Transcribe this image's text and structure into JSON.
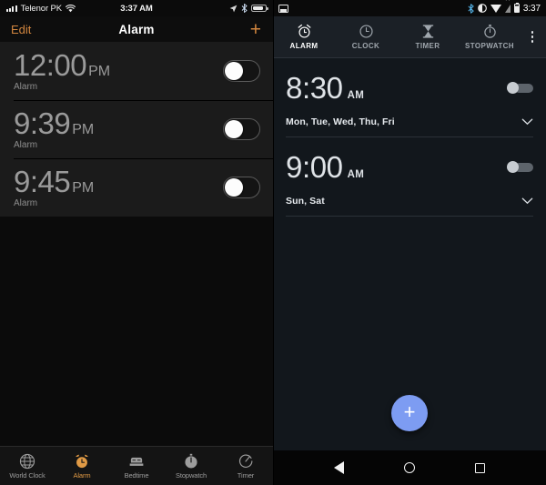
{
  "ios": {
    "status": {
      "carrier": "Telenor PK",
      "time": "3:37 AM",
      "icons": [
        "signal-bars-icon",
        "wifi-icon",
        "location-arrow-icon",
        "bluetooth-icon",
        "battery-icon"
      ]
    },
    "nav": {
      "edit_label": "Edit",
      "title": "Alarm",
      "add_label": "+"
    },
    "alarms": [
      {
        "time": "12:00",
        "meridiem": "PM",
        "label": "Alarm",
        "enabled": false
      },
      {
        "time": "9:39",
        "meridiem": "PM",
        "label": "Alarm",
        "enabled": false
      },
      {
        "time": "9:45",
        "meridiem": "PM",
        "label": "Alarm",
        "enabled": false
      }
    ],
    "tabs": [
      {
        "label": "World Clock",
        "icon": "globe-icon",
        "active": false
      },
      {
        "label": "Alarm",
        "icon": "alarm-clock-icon",
        "active": true
      },
      {
        "label": "Bedtime",
        "icon": "bed-icon",
        "active": false
      },
      {
        "label": "Stopwatch",
        "icon": "stopwatch-icon",
        "active": false
      },
      {
        "label": "Timer",
        "icon": "timer-icon",
        "active": false
      }
    ],
    "colors": {
      "accent": "#d2863f",
      "row_bg": "#1b1b1b",
      "time_text": "#9a9a9a"
    }
  },
  "android": {
    "status": {
      "time": "3:37",
      "icons": [
        "image-notification-icon",
        "bluetooth-icon",
        "vibrate-icon",
        "wifi-icon",
        "cellular-off-icon",
        "battery-icon"
      ]
    },
    "tabs": [
      {
        "label": "ALARM",
        "icon": "alarm-clock-icon",
        "active": true
      },
      {
        "label": "CLOCK",
        "icon": "clock-icon",
        "active": false
      },
      {
        "label": "TIMER",
        "icon": "hourglass-icon",
        "active": false
      },
      {
        "label": "STOPWATCH",
        "icon": "stopwatch-icon",
        "active": false
      }
    ],
    "overflow_label": "More options",
    "alarms": [
      {
        "time": "8:30",
        "meridiem": "AM",
        "days": "Mon, Tue, Wed, Thu, Fri",
        "enabled": false
      },
      {
        "time": "9:00",
        "meridiem": "AM",
        "days": "Sun, Sat",
        "enabled": false
      }
    ],
    "fab_label": "+",
    "navbar": [
      {
        "label": "Back",
        "icon": "back-triangle-icon"
      },
      {
        "label": "Home",
        "icon": "home-circle-icon"
      },
      {
        "label": "Recents",
        "icon": "recents-square-icon"
      }
    ],
    "colors": {
      "fab": "#7d9cf2",
      "bg": "#12171c",
      "tabbar": "#1b2026"
    }
  }
}
